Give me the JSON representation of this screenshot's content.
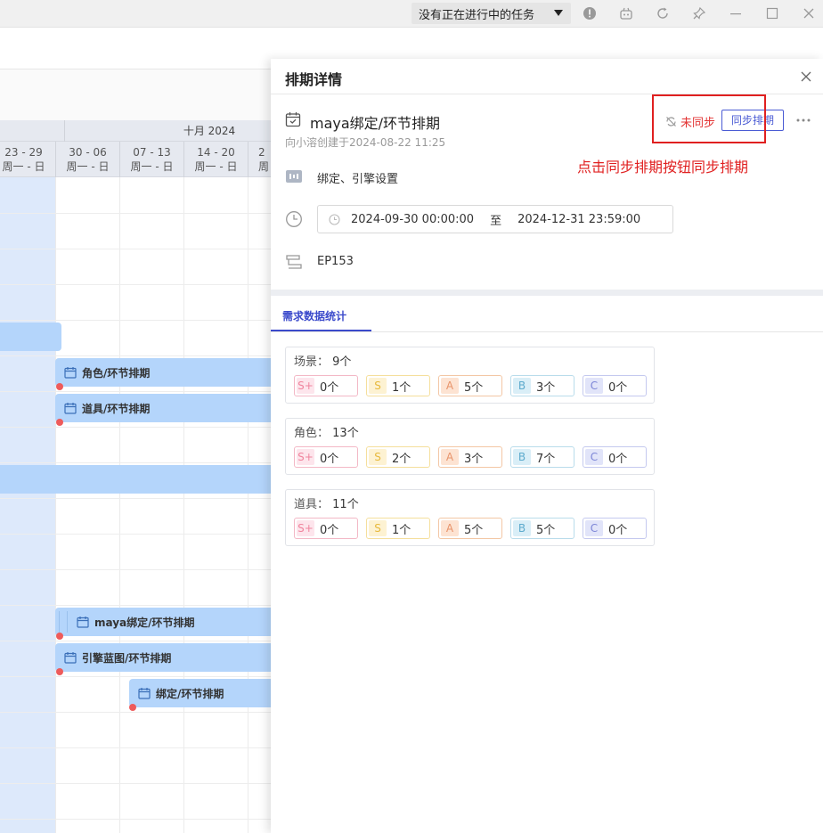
{
  "titlebar": {
    "task_status": "没有正在进行中的任务",
    "icons": [
      "info-icon",
      "bot-icon",
      "refresh-icon",
      "pin-icon",
      "minimize-icon",
      "maximize-icon",
      "close-icon"
    ]
  },
  "gantt": {
    "month_label": "十月 2024",
    "weeks": [
      {
        "range": "23 - 29",
        "days": "周一 - 日"
      },
      {
        "range": "30 - 06",
        "days": "周一 - 日"
      },
      {
        "range": "07 - 13",
        "days": "周一 - 日"
      },
      {
        "range": "14 - 20",
        "days": "周一 - 日"
      },
      {
        "range": "2",
        "days": "周"
      }
    ],
    "bars": {
      "role": "角色/环节排期",
      "prop": "道具/环节排期",
      "maya": "maya绑定/环节排期",
      "engine": "引擎蓝图/环节排期",
      "bind": "绑定/环节排期"
    }
  },
  "drawer": {
    "title": "排期详情",
    "task_title": "maya绑定/环节排期",
    "creator_line": "向小溶创建于2024-08-22 11:25",
    "sync_status": "未同步",
    "sync_button": "同步排期",
    "hint": "点击同步排期按钮同步排期",
    "stage": "绑定、引擎设置",
    "date_start": "2024-09-30 00:00:00",
    "date_sep": "至",
    "date_end": "2024-12-31 23:59:00",
    "episode": "EP153",
    "tab": "需求数据统计",
    "stats": [
      {
        "label": "场景：",
        "total": "9个",
        "grades": [
          {
            "badge": "S+",
            "count": "0个"
          },
          {
            "badge": "S",
            "count": "1个"
          },
          {
            "badge": "A",
            "count": "5个"
          },
          {
            "badge": "B",
            "count": "3个"
          },
          {
            "badge": "C",
            "count": "0个"
          }
        ]
      },
      {
        "label": "角色：",
        "total": "13个",
        "grades": [
          {
            "badge": "S+",
            "count": "0个"
          },
          {
            "badge": "S",
            "count": "2个"
          },
          {
            "badge": "A",
            "count": "3个"
          },
          {
            "badge": "B",
            "count": "7个"
          },
          {
            "badge": "C",
            "count": "0个"
          }
        ]
      },
      {
        "label": "道具：",
        "total": "11个",
        "grades": [
          {
            "badge": "S+",
            "count": "0个"
          },
          {
            "badge": "S",
            "count": "1个"
          },
          {
            "badge": "A",
            "count": "5个"
          },
          {
            "badge": "B",
            "count": "5个"
          },
          {
            "badge": "C",
            "count": "0个"
          }
        ]
      }
    ]
  },
  "colors": {
    "accent": "#3b4acb",
    "alert_red": "#e02020",
    "bar_blue": "#b4d5fb",
    "shade_blue": "#dde9fb"
  }
}
